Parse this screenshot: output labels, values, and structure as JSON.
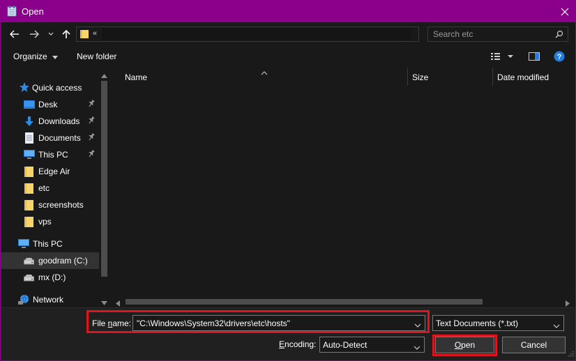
{
  "window": {
    "title": "Open"
  },
  "address": {
    "chevrons": "«",
    "search_placeholder": "Search etc"
  },
  "toolbar": {
    "organize_label": "Organize",
    "new_folder_label": "New folder"
  },
  "nav": {
    "quick_access": "Quick access",
    "items": [
      {
        "label": "Desk",
        "icon": "desktop-icon",
        "pinned": true
      },
      {
        "label": "Downloads",
        "icon": "download-arrow-icon",
        "pinned": true
      },
      {
        "label": "Documents",
        "icon": "documents-icon",
        "pinned": true
      },
      {
        "label": "This PC",
        "icon": "monitor-icon",
        "pinned": true
      },
      {
        "label": "Edge Air",
        "icon": "folder-icon",
        "pinned": false
      },
      {
        "label": "etc",
        "icon": "folder-icon",
        "pinned": false
      },
      {
        "label": "screenshots",
        "icon": "folder-icon",
        "pinned": false
      },
      {
        "label": "vps",
        "icon": "folder-icon",
        "pinned": false
      }
    ],
    "this_pc": "This PC",
    "drives": [
      {
        "label": "goodram (C:)",
        "selected": true
      },
      {
        "label": "mx (D:)",
        "selected": false
      }
    ],
    "network": "Network"
  },
  "columns": {
    "name": "Name",
    "size": "Size",
    "date_modified": "Date modified"
  },
  "bottom": {
    "file_name_label": "File name:",
    "file_name_value": "\"C:\\Windows\\System32\\drivers\\etc\\hosts\"",
    "file_type": "Text Documents (*.txt)",
    "encoding_label": "Encoding:",
    "encoding_value": "Auto-Detect",
    "open_label": "Open",
    "cancel_label": "Cancel"
  },
  "colors": {
    "title_bar": "#8b008b",
    "highlight": "#e0141e",
    "folder": "#f7d56b",
    "accent_blue": "#1f7fe0"
  }
}
